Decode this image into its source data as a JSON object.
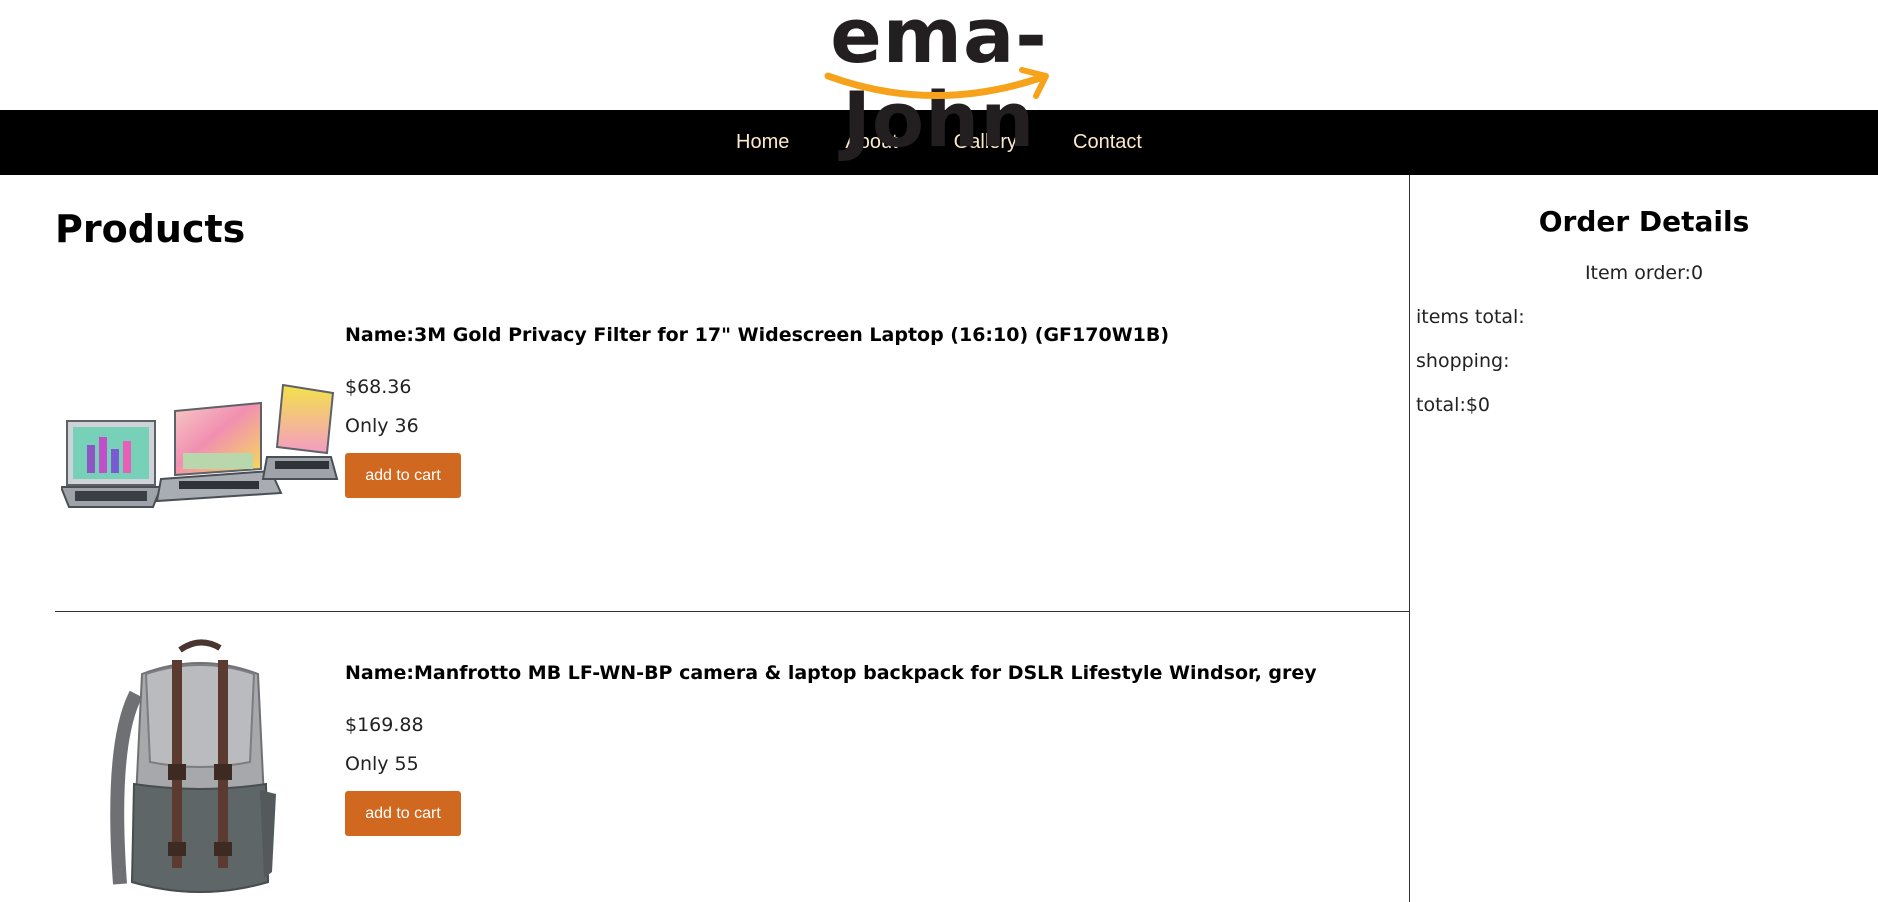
{
  "header": {
    "logo_text": "ema-John",
    "logo_accent": "#f7a21b"
  },
  "nav": {
    "items": [
      "Home",
      "About",
      "Gallery",
      "Contact"
    ],
    "bg": "#000000",
    "color": "#fde9c8"
  },
  "products": {
    "title": "Products",
    "items": [
      {
        "name": "Name:3M Gold Privacy Filter for 17\" Widescreen Laptop (16:10) (GF170W1B)",
        "price": "$68.36",
        "stock": "Only 36",
        "button": "add to cart",
        "image": "laptop-privacy-filter-image"
      },
      {
        "name": "Name:Manfrotto MB LF-WN-BP camera & laptop backpack for DSLR Lifestyle Windsor, grey",
        "price": "$169.88",
        "stock": "Only 55",
        "button": "add to cart",
        "image": "grey-backpack-image"
      }
    ],
    "button_color": "#d0691f"
  },
  "order": {
    "title": "Order Details",
    "item_order": "Item order:0",
    "items_total": "items total:",
    "shopping": "shopping:",
    "total": "total:$0"
  }
}
